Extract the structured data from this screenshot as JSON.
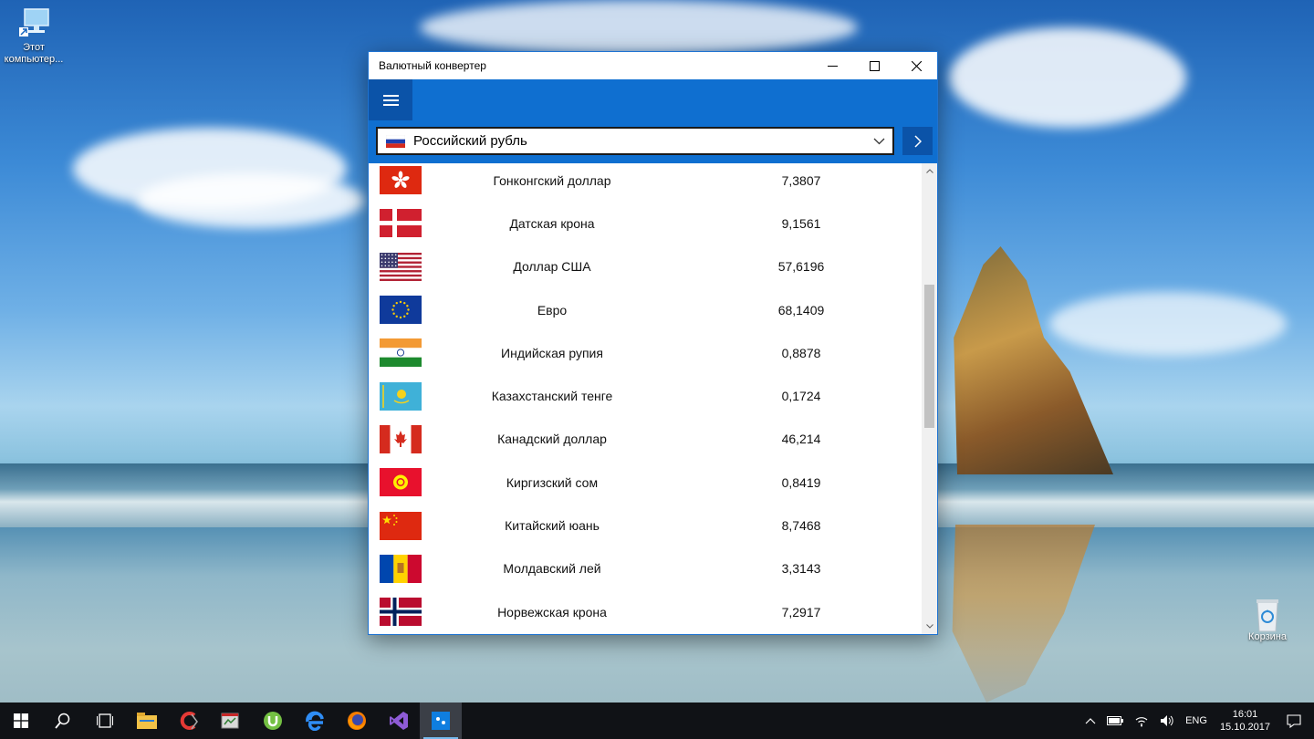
{
  "desktop": {
    "this_pc_label": "Этот компьютер...",
    "recycle_bin_label": "Корзина"
  },
  "window": {
    "title": "Валютный конвертер",
    "selected_currency": "Российский рубль",
    "accent_color": "#0f6fd0",
    "rows": [
      {
        "flag": "hk",
        "name": "Гонконгский доллар",
        "value": "7,3807"
      },
      {
        "flag": "dk",
        "name": "Датская крона",
        "value": "9,1561"
      },
      {
        "flag": "us",
        "name": "Доллар США",
        "value": "57,6196"
      },
      {
        "flag": "eu",
        "name": "Евро",
        "value": "68,1409"
      },
      {
        "flag": "in",
        "name": "Индийская рупия",
        "value": "0,8878"
      },
      {
        "flag": "kz",
        "name": "Казахстанский тенге",
        "value": "0,1724"
      },
      {
        "flag": "ca",
        "name": "Канадский доллар",
        "value": "46,214"
      },
      {
        "flag": "kg",
        "name": "Киргизский сом",
        "value": "0,8419"
      },
      {
        "flag": "cn",
        "name": "Китайский юань",
        "value": "8,7468"
      },
      {
        "flag": "md",
        "name": "Молдавский лей",
        "value": "3,3143"
      },
      {
        "flag": "no",
        "name": "Норвежская крона",
        "value": "7,2917"
      }
    ]
  },
  "taskbar": {
    "apps": [
      "start-icon",
      "search-icon",
      "task-view-icon",
      "file-explorer-icon",
      "ccleaner-icon",
      "task-manager-icon",
      "utorrent-icon",
      "edge-icon",
      "firefox-icon",
      "visual-studio-icon",
      "currency-converter-icon"
    ],
    "language": "ENG",
    "time": "16:01",
    "date": "15.10.2017"
  }
}
